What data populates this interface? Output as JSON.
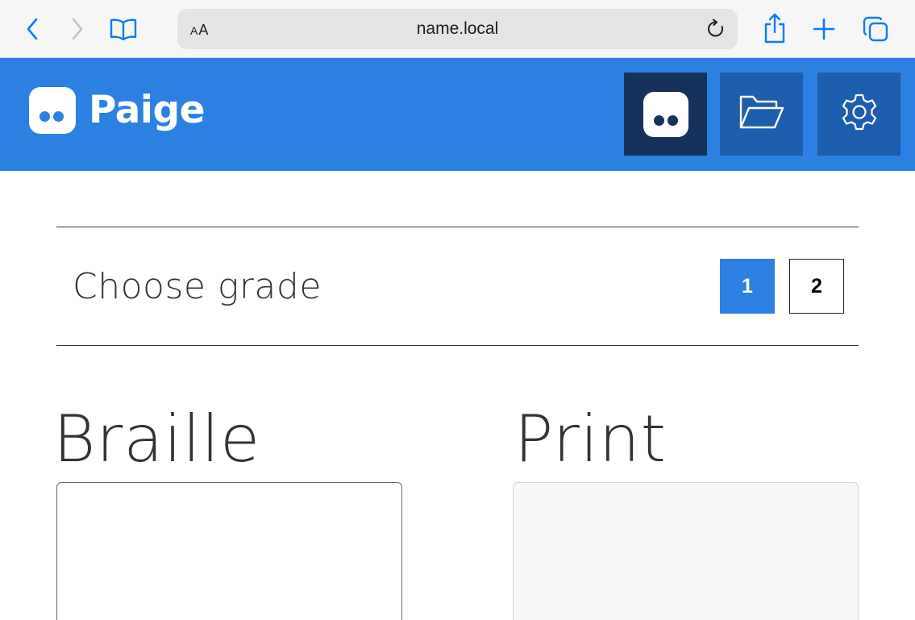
{
  "browser": {
    "reader_label_small": "A",
    "reader_label_large": "A",
    "url": "name.local",
    "icons": [
      "back-icon",
      "forward-icon",
      "bookmarks-icon",
      "reload-icon",
      "share-icon",
      "new-tab-icon",
      "tabs-icon"
    ]
  },
  "header": {
    "brand": "Paige",
    "accent_color": "#2b80e2",
    "active_button_color": "#16325c",
    "icons": [
      "paige-logo-icon",
      "folder-icon",
      "gear-icon"
    ]
  },
  "grade": {
    "label": "Choose grade",
    "options": [
      "1",
      "2"
    ],
    "selected": "1"
  },
  "panels": {
    "braille_title": "Braille",
    "print_title": "Print"
  }
}
